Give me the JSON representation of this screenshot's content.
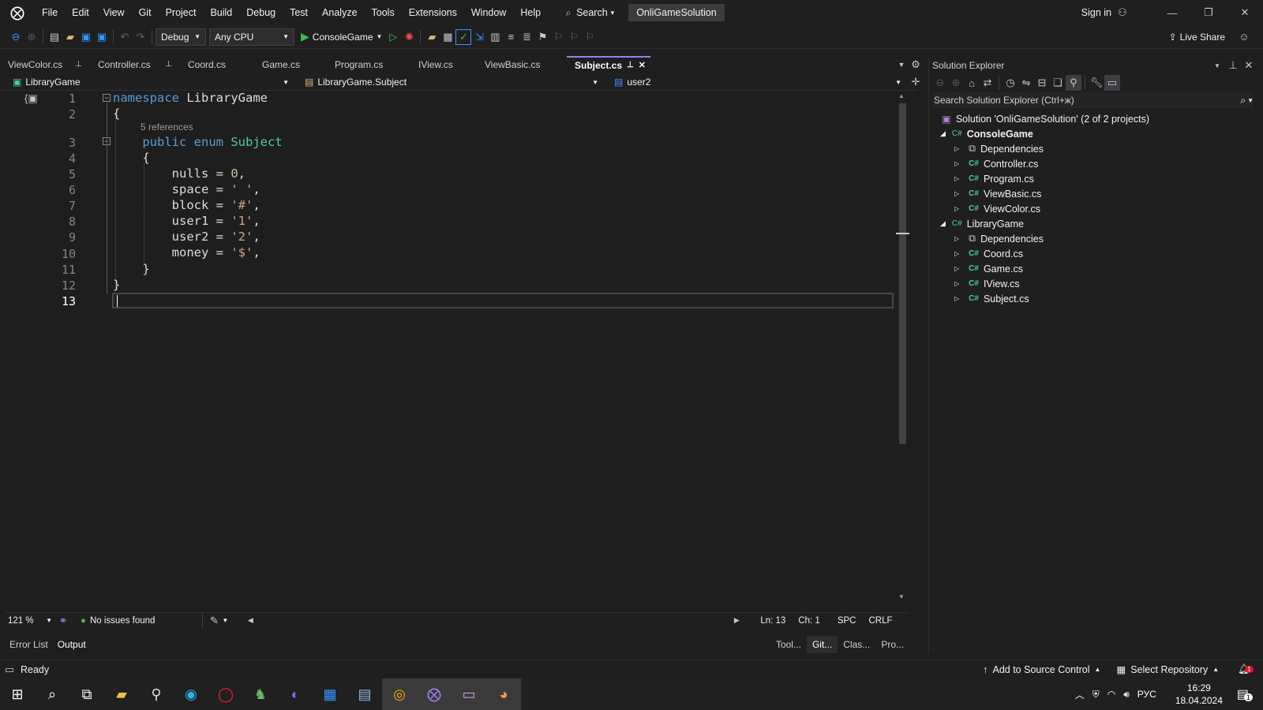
{
  "menubar": {
    "items": [
      "File",
      "Edit",
      "View",
      "Git",
      "Project",
      "Build",
      "Debug",
      "Test",
      "Analyze",
      "Tools",
      "Extensions",
      "Window",
      "Help"
    ],
    "search_label": "Search",
    "solution_name": "OnliGameSolution",
    "sign_in": "Sign in"
  },
  "toolbar": {
    "config": "Debug",
    "platform": "Any CPU",
    "start_label": "ConsoleGame",
    "live_share": "Live Share"
  },
  "tabs": [
    {
      "label": "ViewColor.cs",
      "pinned": true
    },
    {
      "label": "Controller.cs",
      "pinned": true
    },
    {
      "label": "Coord.cs",
      "pinned": false
    },
    {
      "label": "Game.cs",
      "pinned": false
    },
    {
      "label": "Program.cs",
      "pinned": false
    },
    {
      "label": "IView.cs",
      "pinned": false
    },
    {
      "label": "ViewBasic.cs",
      "pinned": false
    },
    {
      "label": "Subject.cs",
      "pinned": true,
      "active": true
    }
  ],
  "navbar": {
    "project": "LibraryGame",
    "type": "LibraryGame.Subject",
    "member": "user2"
  },
  "editor": {
    "line_numbers": [
      "1",
      "2",
      "3",
      "4",
      "5",
      "6",
      "7",
      "8",
      "9",
      "10",
      "11",
      "12",
      "13"
    ],
    "codelens": "5 references",
    "code": {
      "l1_kw": "namespace",
      "l1_name": "LibraryGame",
      "l2": "{",
      "l3_kw1": "public",
      "l3_kw2": "enum",
      "l3_type": "Subject",
      "l4": "{",
      "members": [
        {
          "name": "nulls",
          "val": "0",
          "type": "num"
        },
        {
          "name": "space",
          "val": "' '",
          "type": "str"
        },
        {
          "name": "block",
          "val": "'#'",
          "type": "str"
        },
        {
          "name": "user1",
          "val": "'1'",
          "type": "str"
        },
        {
          "name": "user2",
          "val": "'2'",
          "type": "str"
        },
        {
          "name": "money",
          "val": "'$'",
          "type": "str"
        }
      ],
      "l11": "}",
      "l12": "}"
    }
  },
  "editor_status": {
    "zoom": "121 %",
    "issues": "No issues found",
    "ln": "Ln: 13",
    "ch": "Ch: 1",
    "spc": "SPC",
    "crlf": "CRLF"
  },
  "bottom_tabs": {
    "left": [
      "Error List",
      "Output"
    ],
    "right": [
      "Tool...",
      "Git...",
      "Clas...",
      "Pro..."
    ]
  },
  "solution_explorer": {
    "title": "Solution Explorer",
    "search_placeholder": "Search Solution Explorer (Ctrl+ж)",
    "solution": "Solution 'OnliGameSolution' (2 of 2 projects)",
    "projects": [
      {
        "name": "ConsoleGame",
        "bold": true,
        "items": [
          "Dependencies",
          "Controller.cs",
          "Program.cs",
          "ViewBasic.cs",
          "ViewColor.cs"
        ]
      },
      {
        "name": "LibraryGame",
        "bold": false,
        "items": [
          "Dependencies",
          "Coord.cs",
          "Game.cs",
          "IView.cs",
          "Subject.cs"
        ]
      }
    ]
  },
  "statusbar": {
    "ready": "Ready",
    "source_control": "Add to Source Control",
    "repository": "Select Repository",
    "notification_count": "1"
  },
  "taskbar": {
    "lang": "РУС",
    "time": "16:29",
    "date": "18.04.2024",
    "notif_count": "1"
  },
  "colors": {
    "accent": "#9184ee",
    "keyword": "#569cd6",
    "type": "#4ec9b0",
    "string": "#d69d85",
    "number": "#b5cea8"
  }
}
